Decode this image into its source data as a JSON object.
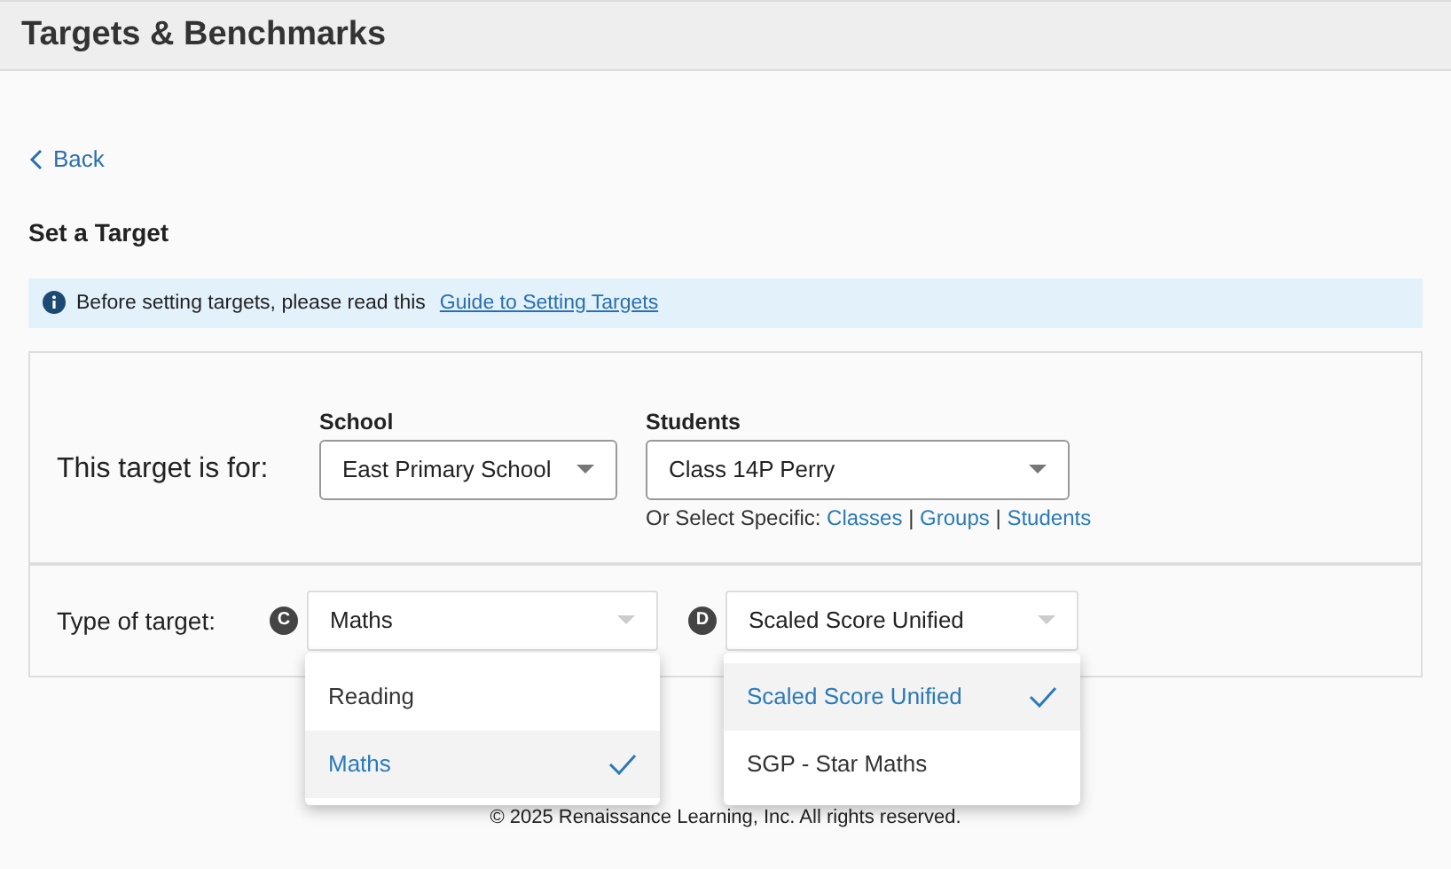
{
  "header": {
    "title": "Targets & Benchmarks"
  },
  "back": {
    "label": "Back"
  },
  "heading": "Set a Target",
  "notice": {
    "text": "Before setting targets, please read this",
    "link": "Guide to Setting Targets"
  },
  "target_for": {
    "label": "This target is for:",
    "school": {
      "label": "School",
      "value": "East Primary School"
    },
    "students": {
      "label": "Students",
      "value": "Class 14P Perry"
    },
    "specific": {
      "prefix": "Or Select Specific:",
      "links": [
        "Classes",
        "Groups",
        "Students"
      ],
      "separators": [
        "|",
        "|"
      ]
    }
  },
  "type_row": {
    "label": "Type of target:",
    "selects": [
      {
        "badge": "C",
        "value": "Maths",
        "expanded": true,
        "options": [
          {
            "label": "Reading",
            "selected": false
          },
          {
            "label": "Maths",
            "selected": true
          }
        ]
      },
      {
        "badge": "D",
        "value": "Scaled Score Unified",
        "expanded": true,
        "options": [
          {
            "label": "Scaled Score Unified",
            "selected": true
          },
          {
            "label": "SGP - Star Maths",
            "selected": false
          }
        ]
      }
    ]
  },
  "footer": "© 2025 Renaissance Learning, Inc. All rights reserved."
}
